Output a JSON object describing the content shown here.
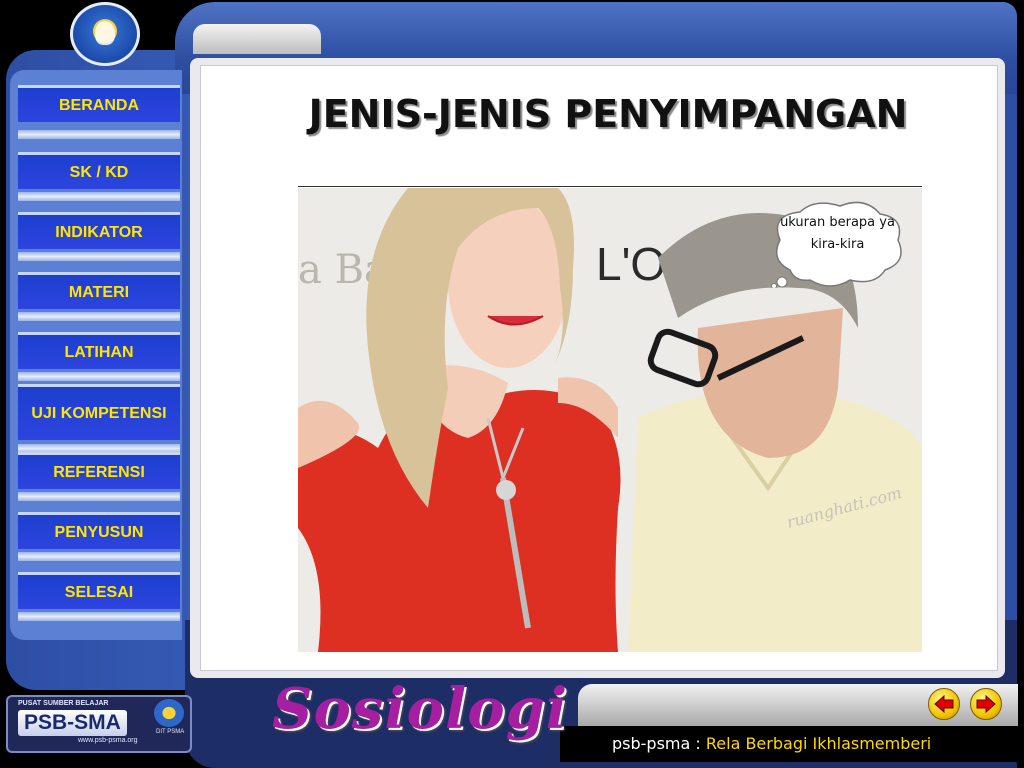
{
  "nav": {
    "items": [
      {
        "label": "BERANDA"
      },
      {
        "label": "SK / KD"
      },
      {
        "label": "INDIKATOR"
      },
      {
        "label": "MATERI"
      },
      {
        "label": "LATIHAN"
      },
      {
        "label": "UJI KOMPETENSI"
      },
      {
        "label": "REFERENSI"
      },
      {
        "label": "PENYUSUN"
      },
      {
        "label": "SELESAI"
      }
    ]
  },
  "slide": {
    "title": "JENIS-JENIS PENYIMPANGAN",
    "bubble_text": "ukuran berapa ya kira-kira",
    "watermark": "ruanghati.com",
    "background_sign_left": "a Ba",
    "background_sign_right": "L'O"
  },
  "branding": {
    "psb_small": "PUSAT SUMBER BELAJAR",
    "psb_main": "PSB-SMA",
    "psb_url": "www.psb-psma.org",
    "psb_emblem_text": "DIT PSMA",
    "subject": "Sosiologi"
  },
  "footer": {
    "prefix": "psb-psma : ",
    "tagline": "Rela Berbagi Ikhlasmemberi"
  },
  "icons": {
    "prev": "arrow-left-icon",
    "next": "arrow-right-icon"
  },
  "colors": {
    "nav_text": "#ffe600",
    "nav_bg": "#1d3fcf",
    "frame": "#2d4ea3",
    "subject": "#a51fa0"
  }
}
